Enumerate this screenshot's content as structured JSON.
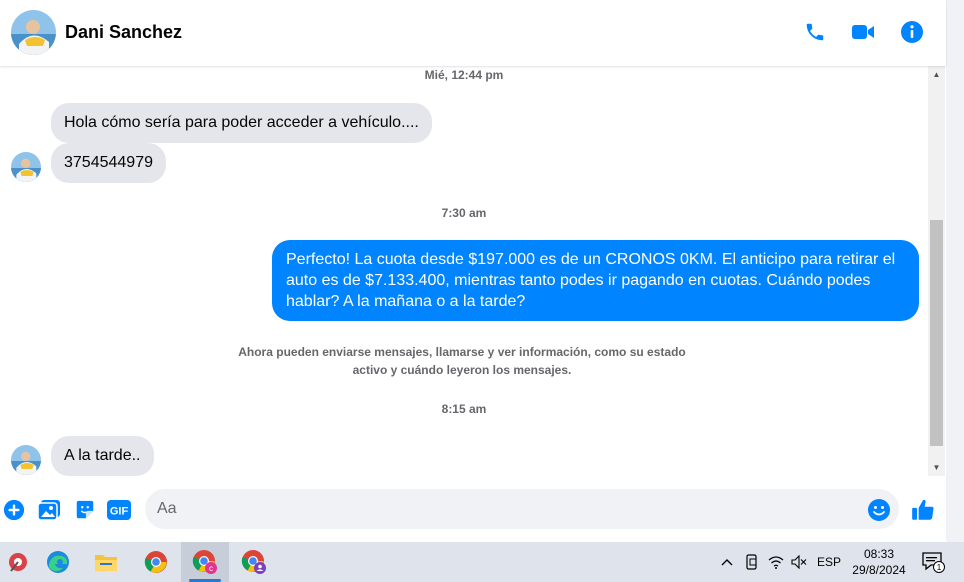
{
  "header": {
    "contact_name": "Dani Sanchez",
    "icons": [
      "phone-icon",
      "video-camera-icon",
      "info-icon"
    ]
  },
  "conversation": {
    "timestamp1": "Mié, 12:44 pm",
    "msg1": "Hola cómo sería para poder acceder a vehículo....",
    "msg2": "3754544979",
    "timestamp2": "7:30 am",
    "msg3": "Perfecto! La cuota desde $197.000 es de un CRONOS 0KM. El anticipo para retirar el auto es de $7.133.400, mientras tanto podes ir pagando en cuotas. Cuándo podes hablar? A la mañana o a la tarde?",
    "notice_line1": "Ahora pueden enviarse mensajes, llamarse y ver información, como su estado",
    "notice_line2": "activo y cuándo leyeron los mensajes.",
    "timestamp3": "8:15 am",
    "msg4": "A la tarde.."
  },
  "composer": {
    "placeholder": "Aa",
    "icons": [
      "plus-icon",
      "photo-icon",
      "sticker-icon",
      "gif-icon",
      "emoji-icon",
      "thumbs-up-icon"
    ],
    "gif_label": "GIF"
  },
  "taskbar": {
    "language": "ESP",
    "time": "08:33",
    "date": "29/8/2024",
    "notification_count": "1"
  },
  "colors": {
    "accent": "#0084ff",
    "incoming_bubble": "#e4e6eb",
    "meta_text": "#65676b"
  }
}
